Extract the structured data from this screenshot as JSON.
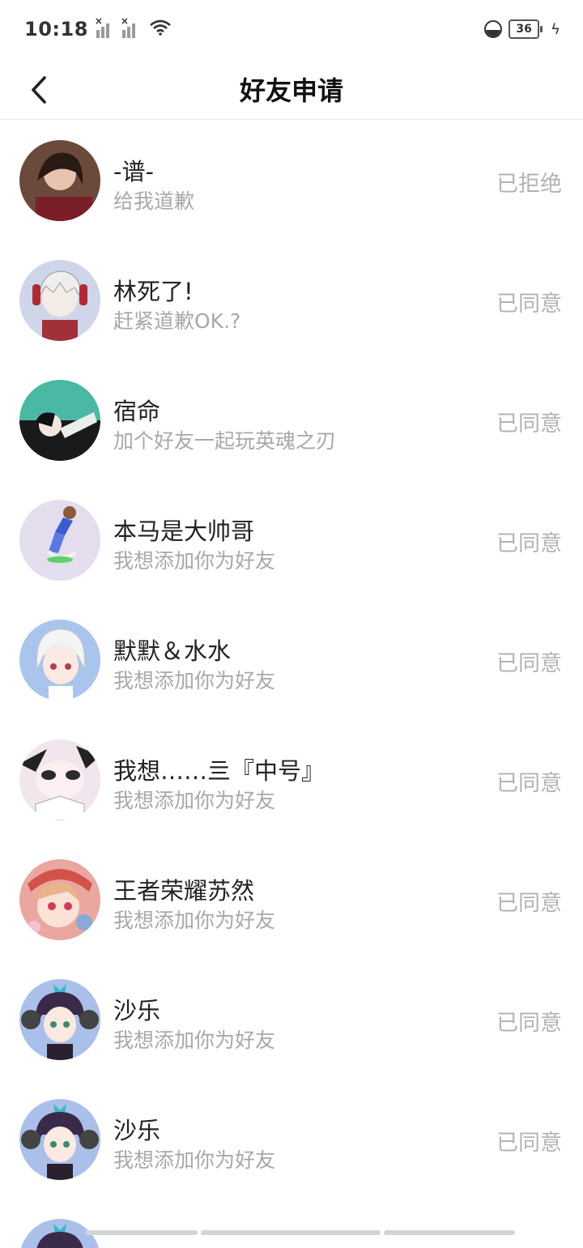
{
  "status_bar": {
    "time": "10:18",
    "battery": "36",
    "icons": [
      "signal-icon",
      "signal-icon",
      "wifi-icon",
      "data-saver-icon",
      "battery-icon",
      "charging-icon"
    ]
  },
  "header": {
    "title": "好友申请",
    "back_icon": "back-arrow-icon"
  },
  "requests": [
    {
      "name": "-谱-",
      "message": "给我道歉",
      "status": "已拒绝",
      "avatar_color": "#6b4a3c"
    },
    {
      "name": "林死了!",
      "message": "赶紧道歉OK.?",
      "status": "已同意",
      "avatar_color": "#cfd6ea"
    },
    {
      "name": "宿命",
      "message": "加个好友一起玩英魂之刃",
      "status": "已同意",
      "avatar_color": "#4bb8a4"
    },
    {
      "name": "本马是大帅哥",
      "message": "我想添加你为好友",
      "status": "已同意",
      "avatar_color": "#e4ddee"
    },
    {
      "name": "默默＆水水",
      "message": "我想添加你为好友",
      "status": "已同意",
      "avatar_color": "#a9c5ec"
    },
    {
      "name": "我想……亖『中号』",
      "message": "我想添加你为好友",
      "status": "已同意",
      "avatar_color": "#f1e6ee"
    },
    {
      "name": "王者荣耀苏然",
      "message": "我想添加你为好友",
      "status": "已同意",
      "avatar_color": "#e9a7a0"
    },
    {
      "name": "沙乐",
      "message": "我想添加你为好友",
      "status": "已同意",
      "avatar_color": "#aac0ea"
    },
    {
      "name": "沙乐",
      "message": "我想添加你为好友",
      "status": "已同意",
      "avatar_color": "#aac0ea"
    }
  ]
}
